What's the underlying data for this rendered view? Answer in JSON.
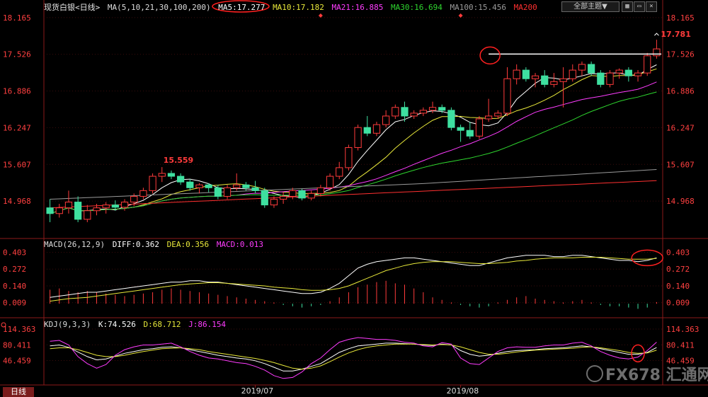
{
  "header": {
    "symbol": "现货白银<日线>",
    "ma_params": "MA(5,10,21,30,100,200)",
    "ma5": "MA5:17.277",
    "ma10": "MA10:17.182",
    "ma21": "MA21:16.885",
    "ma30": "MA30:16.694",
    "ma100": "MA100:15.456",
    "ma200": "MA200",
    "theme_button": "全部主题▼"
  },
  "macd_header": {
    "params": "MACD(26,12,9)",
    "diff": "DIFF:0.362",
    "dea": "DEA:0.356",
    "macd": "MACD:0.013"
  },
  "kdj_header": {
    "params": "KDJ(9,3,3)",
    "k": "K:74.526",
    "d": "D:68.712",
    "j": "J:86.154"
  },
  "timeframe_tab": "日线",
  "x_labels": [
    "2019/07",
    "2019/08"
  ],
  "watermark": "FX678 汇通网",
  "colors": {
    "up": "#ff3b3b",
    "down": "#3ee0a0",
    "ma5": "#ffffff",
    "ma10": "#e8e83a",
    "ma21": "#ff3cff",
    "ma30": "#2ed52e",
    "ma100": "#9a9a9a",
    "ma200": "#ff3030",
    "axis": "#8b1a1a",
    "annot": "#ff2020"
  },
  "chart_data": [
    {
      "type": "candlestick",
      "title": "",
      "yticks": [
        "18.165",
        "17.526",
        "16.886",
        "16.247",
        "15.607",
        "14.968"
      ],
      "ylim": [
        14.55,
        18.25
      ],
      "annotations": [
        "15.559",
        "17.781"
      ],
      "reference_line": 17.53,
      "candles": [
        {
          "o": 14.85,
          "h": 15.0,
          "l": 14.6,
          "c": 14.75
        },
        {
          "o": 14.75,
          "h": 14.92,
          "l": 14.68,
          "c": 14.85
        },
        {
          "o": 14.85,
          "h": 15.15,
          "l": 14.75,
          "c": 14.95
        },
        {
          "o": 14.95,
          "h": 15.05,
          "l": 14.6,
          "c": 14.65
        },
        {
          "o": 14.65,
          "h": 14.9,
          "l": 14.6,
          "c": 14.8
        },
        {
          "o": 14.8,
          "h": 14.92,
          "l": 14.72,
          "c": 14.85
        },
        {
          "o": 14.85,
          "h": 14.95,
          "l": 14.75,
          "c": 14.9
        },
        {
          "o": 14.9,
          "h": 14.98,
          "l": 14.8,
          "c": 14.86
        },
        {
          "o": 14.86,
          "h": 15.0,
          "l": 14.8,
          "c": 14.95
        },
        {
          "o": 14.95,
          "h": 15.1,
          "l": 14.88,
          "c": 15.05
        },
        {
          "o": 15.05,
          "h": 15.2,
          "l": 15.0,
          "c": 15.15
        },
        {
          "o": 15.15,
          "h": 15.45,
          "l": 15.1,
          "c": 15.4
        },
        {
          "o": 15.4,
          "h": 15.56,
          "l": 15.3,
          "c": 15.45
        },
        {
          "o": 15.45,
          "h": 15.5,
          "l": 15.35,
          "c": 15.4
        },
        {
          "o": 15.4,
          "h": 15.45,
          "l": 15.25,
          "c": 15.3
        },
        {
          "o": 15.3,
          "h": 15.35,
          "l": 15.15,
          "c": 15.2
        },
        {
          "o": 15.2,
          "h": 15.28,
          "l": 15.1,
          "c": 15.25
        },
        {
          "o": 15.25,
          "h": 15.28,
          "l": 15.12,
          "c": 15.2
        },
        {
          "o": 15.2,
          "h": 15.25,
          "l": 15.0,
          "c": 15.05
        },
        {
          "o": 15.05,
          "h": 15.25,
          "l": 15.0,
          "c": 15.2
        },
        {
          "o": 15.2,
          "h": 15.45,
          "l": 15.15,
          "c": 15.25
        },
        {
          "o": 15.25,
          "h": 15.3,
          "l": 15.15,
          "c": 15.2
        },
        {
          "o": 15.2,
          "h": 15.32,
          "l": 15.1,
          "c": 15.15
        },
        {
          "o": 15.15,
          "h": 15.2,
          "l": 14.85,
          "c": 14.9
        },
        {
          "o": 14.9,
          "h": 15.05,
          "l": 14.85,
          "c": 15.0
        },
        {
          "o": 15.0,
          "h": 15.12,
          "l": 14.92,
          "c": 15.05
        },
        {
          "o": 15.05,
          "h": 15.2,
          "l": 15.0,
          "c": 15.15
        },
        {
          "o": 15.15,
          "h": 15.18,
          "l": 14.98,
          "c": 15.02
        },
        {
          "o": 15.02,
          "h": 15.15,
          "l": 14.98,
          "c": 15.1
        },
        {
          "o": 15.1,
          "h": 15.25,
          "l": 15.05,
          "c": 15.2
        },
        {
          "o": 15.2,
          "h": 15.45,
          "l": 15.15,
          "c": 15.4
        },
        {
          "o": 15.4,
          "h": 15.65,
          "l": 15.35,
          "c": 15.55
        },
        {
          "o": 15.55,
          "h": 15.95,
          "l": 15.5,
          "c": 15.9
        },
        {
          "o": 15.9,
          "h": 16.3,
          "l": 15.85,
          "c": 16.25
        },
        {
          "o": 16.25,
          "h": 16.45,
          "l": 16.1,
          "c": 16.15
        },
        {
          "o": 16.15,
          "h": 16.35,
          "l": 16.1,
          "c": 16.3
        },
        {
          "o": 16.3,
          "h": 16.55,
          "l": 16.25,
          "c": 16.45
        },
        {
          "o": 16.45,
          "h": 16.65,
          "l": 16.4,
          "c": 16.6
        },
        {
          "o": 16.6,
          "h": 16.7,
          "l": 16.35,
          "c": 16.45
        },
        {
          "o": 16.45,
          "h": 16.55,
          "l": 16.4,
          "c": 16.5
        },
        {
          "o": 16.5,
          "h": 16.6,
          "l": 16.45,
          "c": 16.55
        },
        {
          "o": 16.55,
          "h": 16.7,
          "l": 16.5,
          "c": 16.6
        },
        {
          "o": 16.6,
          "h": 16.65,
          "l": 16.5,
          "c": 16.55
        },
        {
          "o": 16.55,
          "h": 16.6,
          "l": 16.2,
          "c": 16.25
        },
        {
          "o": 16.25,
          "h": 16.3,
          "l": 16.0,
          "c": 16.2
        },
        {
          "o": 16.2,
          "h": 16.35,
          "l": 16.05,
          "c": 16.1
        },
        {
          "o": 16.1,
          "h": 16.45,
          "l": 16.05,
          "c": 16.4
        },
        {
          "o": 16.4,
          "h": 16.75,
          "l": 16.35,
          "c": 16.45
        },
        {
          "o": 16.45,
          "h": 16.55,
          "l": 16.4,
          "c": 16.5
        },
        {
          "o": 16.5,
          "h": 17.3,
          "l": 16.45,
          "c": 17.1
        },
        {
          "o": 17.1,
          "h": 17.35,
          "l": 17.0,
          "c": 17.25
        },
        {
          "o": 17.25,
          "h": 17.3,
          "l": 17.05,
          "c": 17.1
        },
        {
          "o": 17.1,
          "h": 17.2,
          "l": 16.95,
          "c": 17.15
        },
        {
          "o": 17.15,
          "h": 17.25,
          "l": 16.95,
          "c": 17.0
        },
        {
          "o": 17.0,
          "h": 17.2,
          "l": 16.95,
          "c": 17.05
        },
        {
          "o": 17.05,
          "h": 17.3,
          "l": 16.6,
          "c": 17.1
        },
        {
          "o": 17.1,
          "h": 17.35,
          "l": 17.05,
          "c": 17.25
        },
        {
          "o": 17.25,
          "h": 17.4,
          "l": 17.15,
          "c": 17.35
        },
        {
          "o": 17.35,
          "h": 17.4,
          "l": 17.15,
          "c": 17.2
        },
        {
          "o": 17.2,
          "h": 17.25,
          "l": 16.95,
          "c": 17.0
        },
        {
          "o": 17.0,
          "h": 17.25,
          "l": 16.95,
          "c": 17.2
        },
        {
          "o": 17.2,
          "h": 17.28,
          "l": 17.1,
          "c": 17.25
        },
        {
          "o": 17.25,
          "h": 17.3,
          "l": 17.05,
          "c": 17.15
        },
        {
          "o": 17.15,
          "h": 17.25,
          "l": 17.05,
          "c": 17.2
        },
        {
          "o": 17.2,
          "h": 17.55,
          "l": 17.15,
          "c": 17.5
        },
        {
          "o": 17.5,
          "h": 17.78,
          "l": 17.45,
          "c": 17.62
        }
      ]
    },
    {
      "type": "macd",
      "yticks": [
        "0.403",
        "0.272",
        "0.140",
        "0.009"
      ],
      "ylim": [
        -0.06,
        0.44
      ],
      "diff": [
        0.05,
        0.06,
        0.07,
        0.08,
        0.09,
        0.09,
        0.1,
        0.11,
        0.12,
        0.13,
        0.14,
        0.15,
        0.16,
        0.17,
        0.17,
        0.18,
        0.18,
        0.17,
        0.17,
        0.16,
        0.15,
        0.14,
        0.13,
        0.12,
        0.11,
        0.1,
        0.09,
        0.08,
        0.08,
        0.09,
        0.12,
        0.16,
        0.22,
        0.28,
        0.31,
        0.33,
        0.34,
        0.35,
        0.36,
        0.36,
        0.35,
        0.34,
        0.33,
        0.32,
        0.31,
        0.3,
        0.3,
        0.32,
        0.34,
        0.36,
        0.37,
        0.38,
        0.38,
        0.38,
        0.37,
        0.37,
        0.38,
        0.38,
        0.37,
        0.36,
        0.35,
        0.34,
        0.34,
        0.33,
        0.34,
        0.36
      ],
      "dea": [
        0.02,
        0.03,
        0.04,
        0.045,
        0.05,
        0.06,
        0.07,
        0.08,
        0.09,
        0.1,
        0.11,
        0.12,
        0.13,
        0.14,
        0.15,
        0.155,
        0.16,
        0.165,
        0.165,
        0.16,
        0.155,
        0.15,
        0.145,
        0.14,
        0.13,
        0.125,
        0.12,
        0.11,
        0.105,
        0.105,
        0.11,
        0.12,
        0.14,
        0.17,
        0.2,
        0.23,
        0.26,
        0.28,
        0.3,
        0.315,
        0.325,
        0.33,
        0.33,
        0.33,
        0.325,
        0.32,
        0.315,
        0.315,
        0.32,
        0.325,
        0.335,
        0.34,
        0.35,
        0.355,
        0.36,
        0.36,
        0.36,
        0.365,
        0.365,
        0.365,
        0.36,
        0.355,
        0.35,
        0.35,
        0.35,
        0.356
      ],
      "hist": [
        0.11,
        0.12,
        0.1,
        0.09,
        0.1,
        0.09,
        0.08,
        0.07,
        0.06,
        0.07,
        0.08,
        0.09,
        0.11,
        0.12,
        0.11,
        0.1,
        0.09,
        0.08,
        0.07,
        0.06,
        0.05,
        0.04,
        0.03,
        0.02,
        0.01,
        -0.01,
        -0.02,
        -0.03,
        -0.02,
        -0.01,
        0.02,
        0.05,
        0.09,
        0.13,
        0.15,
        0.17,
        0.18,
        0.16,
        0.15,
        0.12,
        0.09,
        0.05,
        0.03,
        0.01,
        -0.01,
        -0.02,
        -0.03,
        -0.02,
        0.01,
        0.03,
        0.05,
        0.06,
        0.04,
        0.03,
        0.02,
        0.01,
        0.02,
        0.03,
        0.01,
        -0.01,
        -0.02,
        -0.02,
        -0.03,
        -0.04,
        -0.03,
        0.013
      ]
    },
    {
      "type": "kdj",
      "yticks": [
        "114.363",
        "80.411",
        "46.459"
      ],
      "ylim": [
        0,
        125
      ],
      "k": [
        78,
        80,
        75,
        65,
        55,
        48,
        50,
        56,
        62,
        66,
        70,
        72,
        75,
        76,
        74,
        70,
        66,
        62,
        58,
        55,
        52,
        50,
        46,
        40,
        32,
        24,
        24,
        28,
        34,
        40,
        52,
        64,
        72,
        78,
        80,
        82,
        84,
        84,
        83,
        82,
        80,
        79,
        82,
        80,
        68,
        60,
        56,
        58,
        62,
        66,
        68,
        69,
        70,
        72,
        73,
        74,
        76,
        78,
        76,
        72,
        68,
        64,
        60,
        60,
        64,
        74.526
      ],
      "d": [
        72,
        74,
        74,
        70,
        64,
        58,
        55,
        55,
        58,
        62,
        66,
        69,
        72,
        73,
        74,
        72,
        70,
        66,
        63,
        60,
        57,
        54,
        51,
        47,
        42,
        36,
        30,
        28,
        30,
        35,
        44,
        54,
        63,
        70,
        75,
        78,
        80,
        82,
        82,
        82,
        81,
        80,
        81,
        80,
        76,
        70,
        64,
        60,
        60,
        62,
        65,
        67,
        69,
        70,
        71,
        72,
        73,
        75,
        76,
        74,
        71,
        68,
        64,
        62,
        63,
        68.712
      ],
      "j": [
        88,
        90,
        80,
        55,
        40,
        30,
        38,
        58,
        70,
        76,
        80,
        80,
        82,
        84,
        76,
        66,
        58,
        52,
        50,
        46,
        42,
        40,
        34,
        26,
        14,
        8,
        10,
        22,
        40,
        52,
        70,
        86,
        92,
        96,
        94,
        92,
        92,
        90,
        86,
        84,
        78,
        76,
        85,
        82,
        52,
        40,
        38,
        52,
        66,
        74,
        76,
        75,
        75,
        78,
        80,
        80,
        84,
        86,
        78,
        66,
        58,
        52,
        50,
        54,
        68,
        86.154
      ]
    }
  ]
}
